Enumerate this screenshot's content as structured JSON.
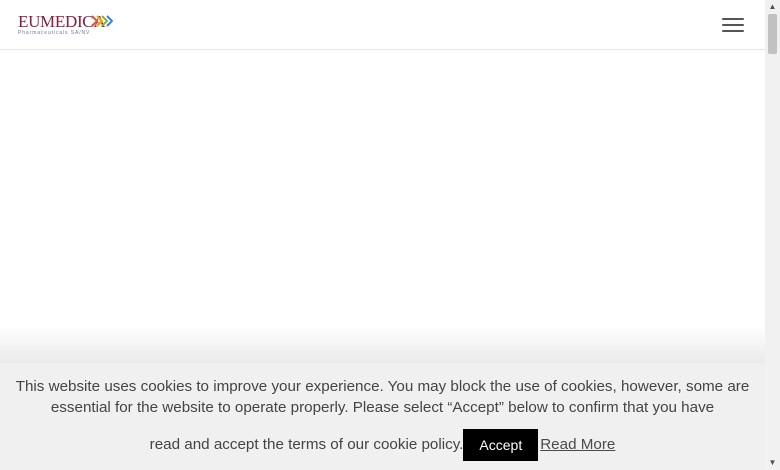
{
  "header": {
    "logo_text": "EUMEDICA",
    "logo_subtext": "Pharmaceuticals SA/NV",
    "menu_icon": "hamburger-menu-icon"
  },
  "cookie_notice": {
    "text_part1": "This website uses cookies to improve your experience. You may block the use of cookies, however, some are essential for the website to operate properly. Please select “Accept” below to confirm that you have",
    "text_part2": "read and accept the terms of our cookie policy.",
    "accept_label": "Accept",
    "read_more_label": "Read More"
  },
  "colors": {
    "logo": "#8a1c3c",
    "cookie_bg": "#f0f0f0",
    "accept_bg": "#000000"
  }
}
